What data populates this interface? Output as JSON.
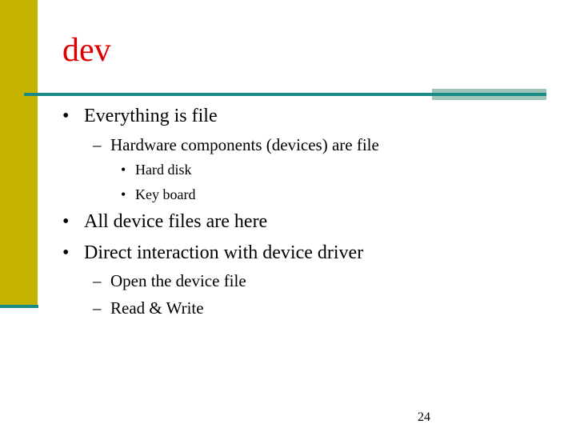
{
  "slide": {
    "title": "dev",
    "bullets": [
      {
        "marker": "•",
        "text": "Everything is file"
      },
      {
        "marker": "–",
        "text": "Hardware components (devices) are file"
      },
      {
        "marker": "•",
        "text": "Hard disk"
      },
      {
        "marker": "•",
        "text": "Key board"
      },
      {
        "marker": "•",
        "text": "All device files are here"
      },
      {
        "marker": "•",
        "text": "Direct interaction with device driver"
      },
      {
        "marker": "–",
        "text": "Open the device file"
      },
      {
        "marker": "–",
        "text": "Read & Write"
      }
    ],
    "page_number": "24",
    "colors": {
      "title": "#dd0000",
      "accent_bar": "#c4b400",
      "rule": "#1a8a86"
    }
  }
}
